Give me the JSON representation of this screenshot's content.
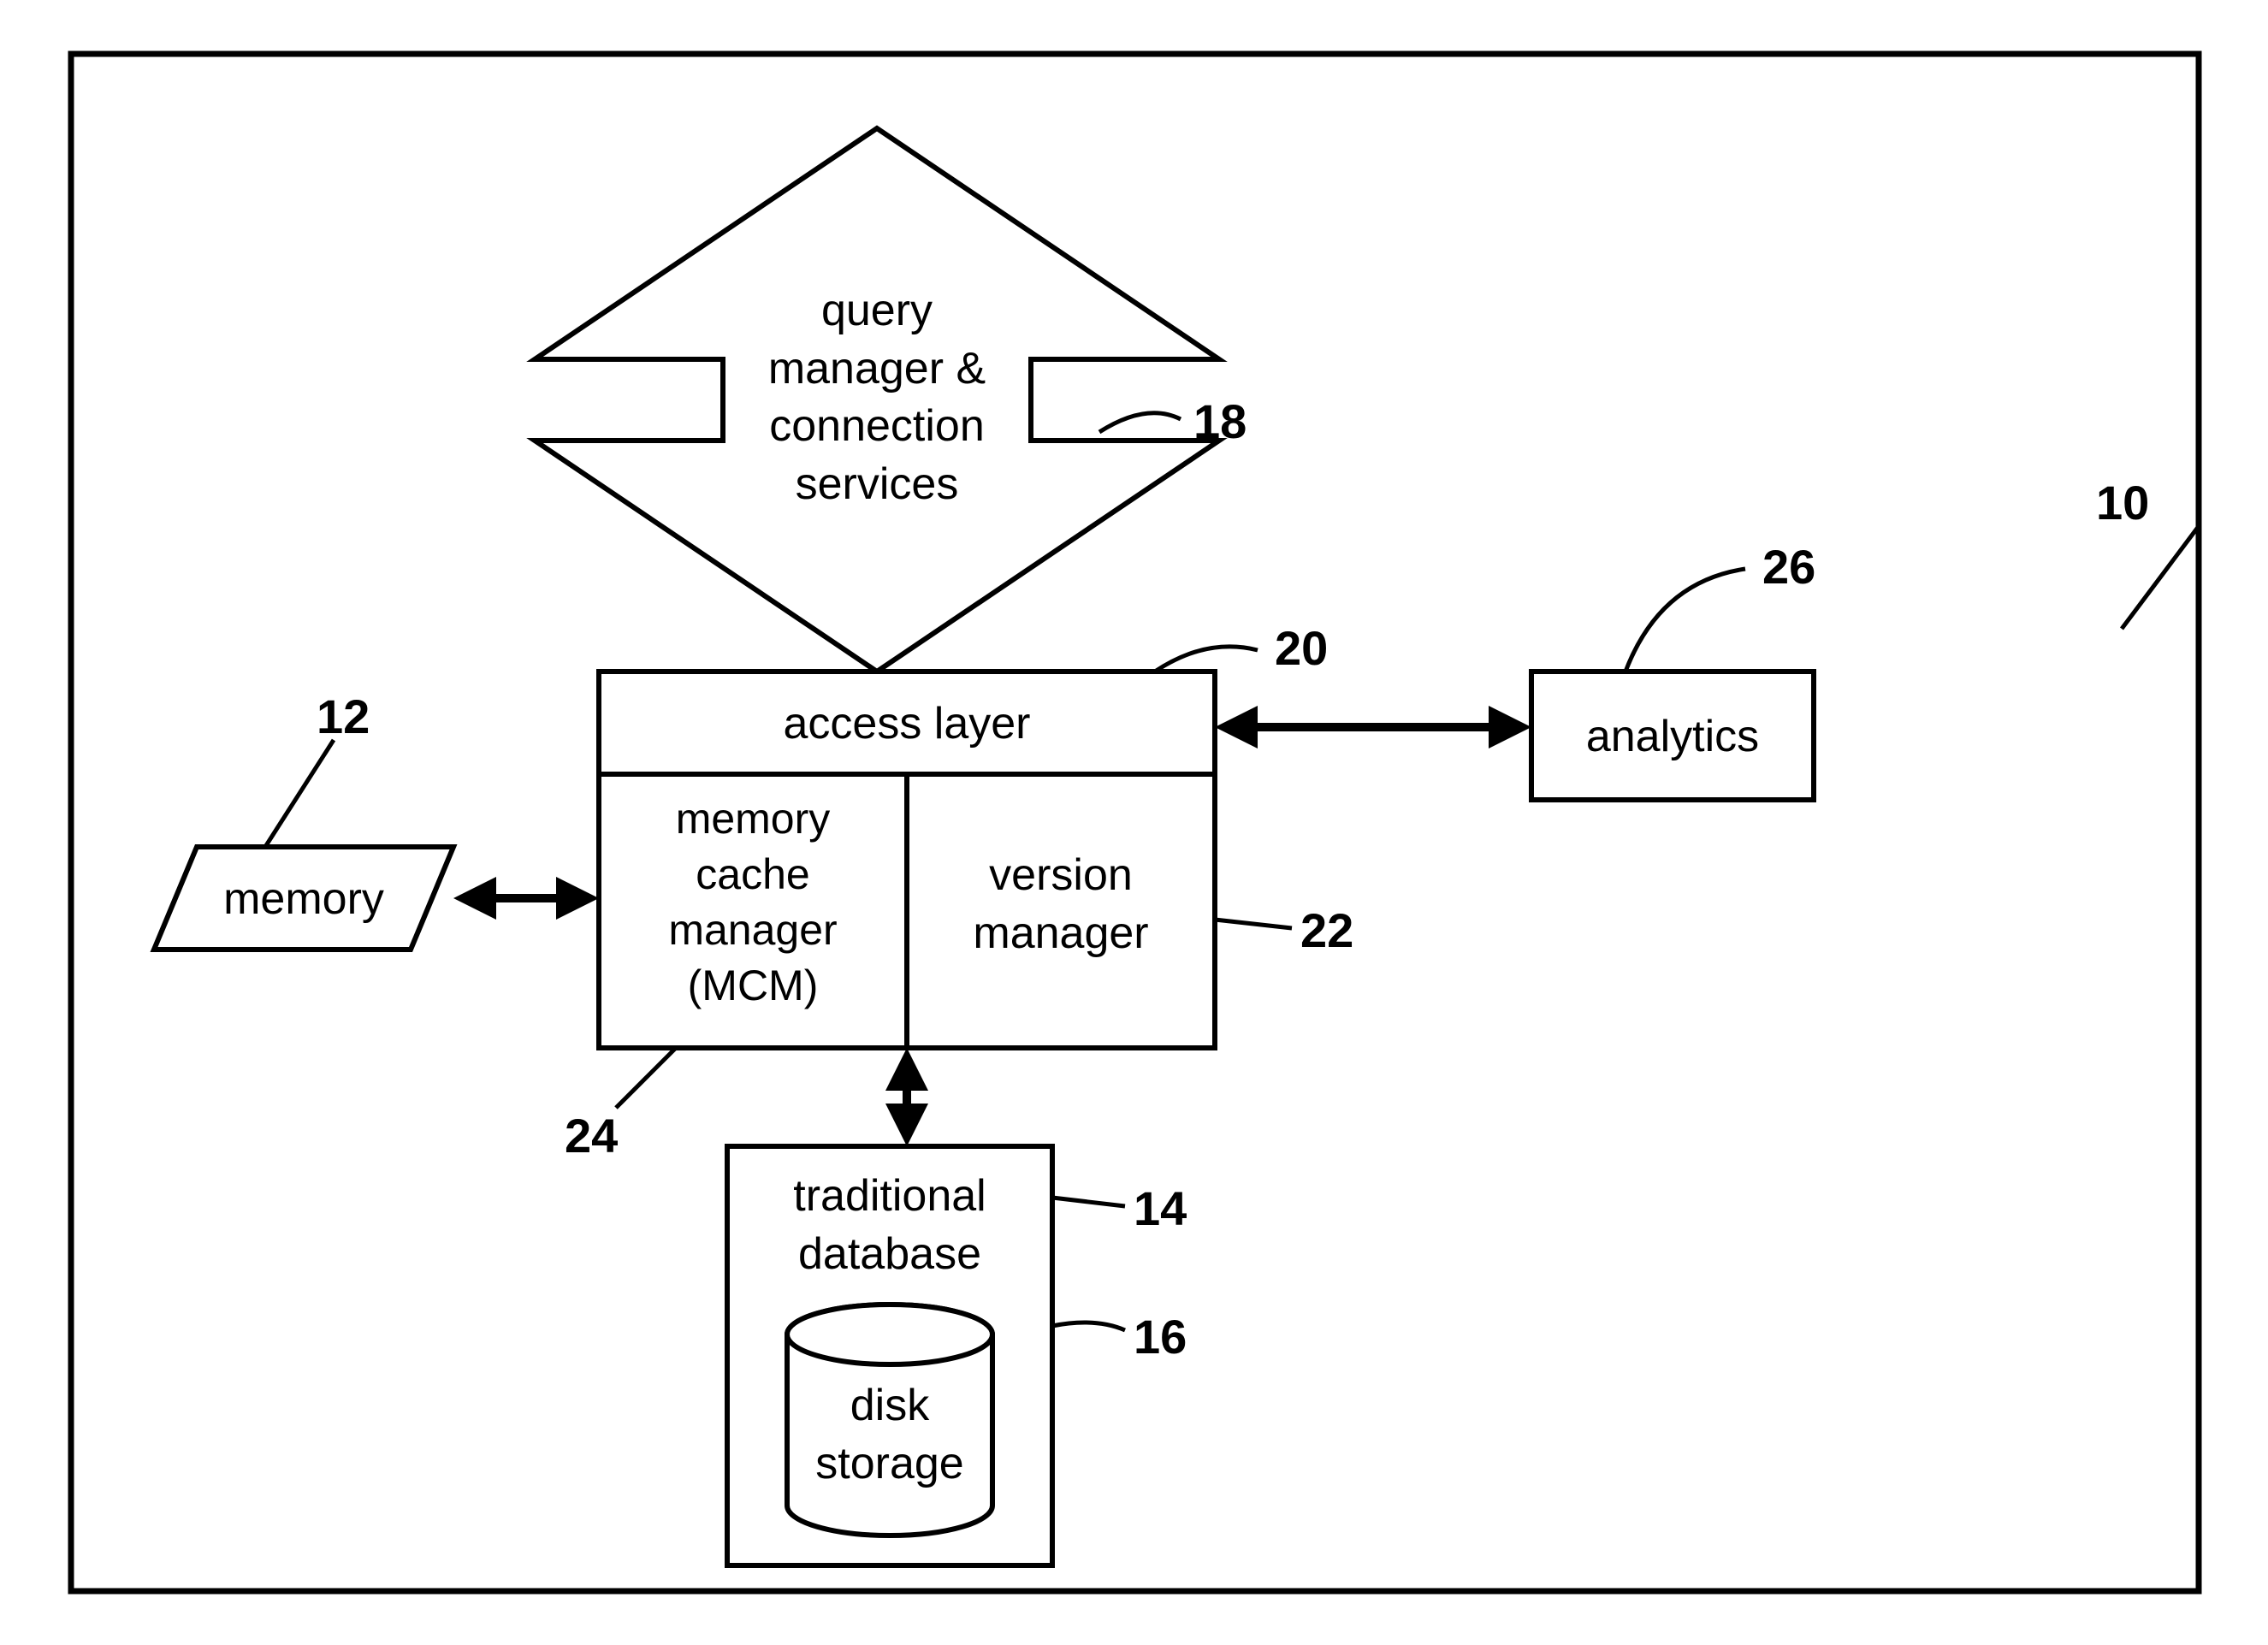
{
  "components": {
    "query_manager": "query\nmanager &\nconnection\nservices",
    "access_layer": "access layer",
    "memory_cache_manager": "memory\ncache\nmanager\n(MCM)",
    "version_manager": "version\nmanager",
    "memory": "memory",
    "analytics": "analytics",
    "traditional_database": "traditional\ndatabase",
    "disk_storage": "disk\nstorage"
  },
  "labels": {
    "l10": "10",
    "l12": "12",
    "l14": "14",
    "l16": "16",
    "l18": "18",
    "l20": "20",
    "l22": "22",
    "l24": "24",
    "l26": "26"
  }
}
